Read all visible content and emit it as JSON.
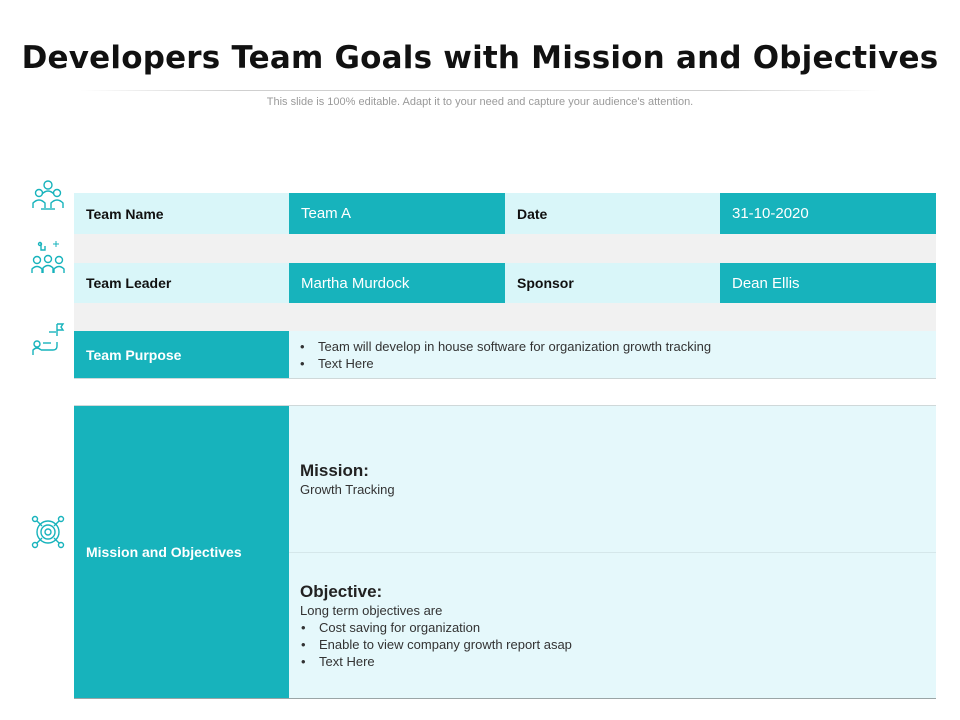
{
  "title": "Developers Team Goals with Mission and Objectives",
  "subtitle": "This slide is 100% editable. Adapt it to your need and capture your audience's attention.",
  "icons": [
    "team-icon",
    "team-leader-icon",
    "team-purpose-icon",
    "target-icon"
  ],
  "colors": {
    "teal": "#17b3bc",
    "light": "#d9f6f9",
    "gray": "#f1f1f1"
  },
  "row1": {
    "label1": "Team Name",
    "value1": "Team A",
    "label2": "Date",
    "value2": "31-10-2020"
  },
  "row2": {
    "label1": "Team Leader",
    "value1": "Martha Murdock",
    "label2": "Sponsor",
    "value2": "Dean Ellis"
  },
  "purpose": {
    "label": "Team Purpose",
    "items": [
      "Team will develop  in house software for organization growth tracking",
      "Text Here"
    ]
  },
  "mission_objectives": {
    "label": "Mission and Objectives",
    "mission_heading": "Mission:",
    "mission_text": "Growth Tracking",
    "objective_heading": "Objective:",
    "objective_intro": "Long term objectives are",
    "objective_items": [
      "Cost saving for organization",
      "Enable to view company growth report asap",
      "Text Here"
    ]
  }
}
